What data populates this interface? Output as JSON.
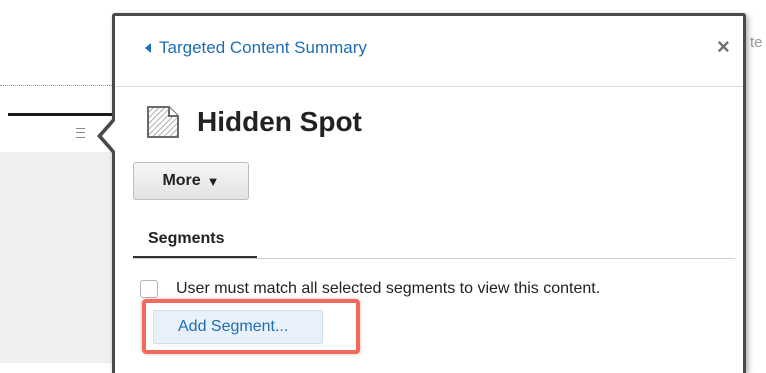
{
  "background": {
    "edge_text": "te"
  },
  "panel": {
    "back_link": "Targeted Content Summary",
    "close_glyph": "×",
    "title": "Hidden Spot",
    "more_button": "More",
    "more_caret": "▼",
    "tabs": [
      {
        "label": "Segments",
        "active": true
      }
    ],
    "checkbox_label": "User must match all selected segments to view this content.",
    "checkbox_checked": false,
    "add_segment_button": "Add Segment..."
  },
  "colors": {
    "link": "#1f6db5",
    "highlight": "#f06a5e",
    "panel_border": "#4a4a4a"
  },
  "icons": [
    "caret-left-icon",
    "close-icon",
    "document-icon",
    "caret-down-icon",
    "list-icon"
  ]
}
